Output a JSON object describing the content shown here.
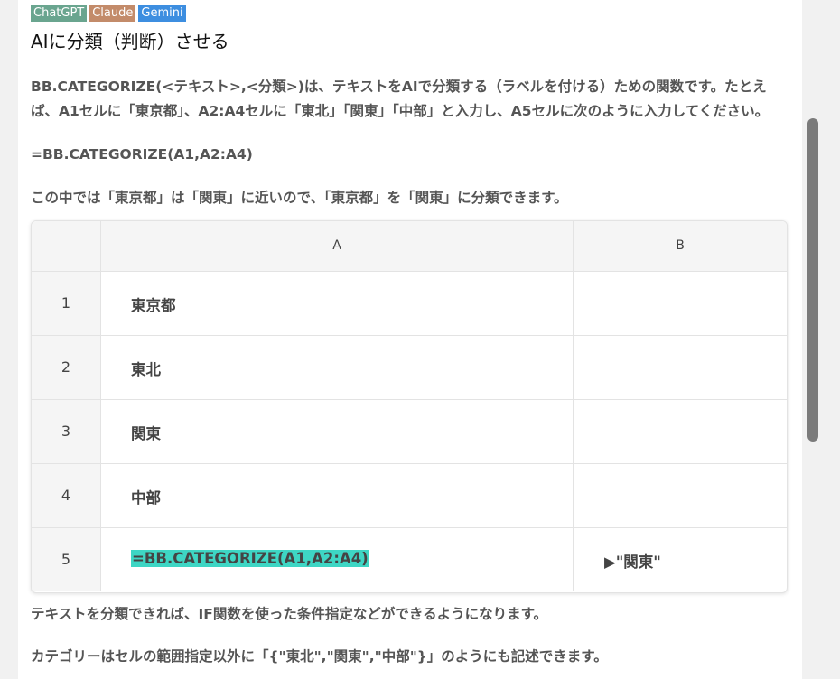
{
  "badges": [
    "ChatGPT",
    "Claude",
    "Gemini"
  ],
  "title": "AIに分類（判断）させる",
  "paragraphs": {
    "intro": "BB.CATEGORIZE(<テキスト>,<分類>)は、テキストをAIで分類する（ラベルを付ける）ための関数です。たとえば、A1セルに「東京都」、A2:A4セルに「東北」「関東」「中部」と入力し、A5セルに次のように入力してください。",
    "formula": "=BB.CATEGORIZE(A1,A2:A4)",
    "explain": "この中では「東京都」は「関東」に近いので、「東京都」を「関東」に分類できます。",
    "after": "テキストを分類できれば、IF関数を使った条件指定などができるようになります。",
    "category_note": "カテゴリーはセルの範囲指定以外に「{\"東北\",\"関東\",\"中部\"}」のようにも記述できます。"
  },
  "sheet": {
    "col_headers": [
      "A",
      "B"
    ],
    "rows": [
      {
        "num": "1",
        "a": "東京都",
        "b": ""
      },
      {
        "num": "2",
        "a": "東北",
        "b": ""
      },
      {
        "num": "3",
        "a": "関東",
        "b": ""
      },
      {
        "num": "4",
        "a": "中部",
        "b": ""
      },
      {
        "num": "5",
        "a": "=BB.CATEGORIZE(A1,A2:A4)",
        "b": "▶\"関東\""
      }
    ]
  },
  "colors": {
    "chatgpt": "#6aa58f",
    "claude": "#c38b6a",
    "gemini": "#3d8ee0",
    "formula_highlight": "#3ed6c4"
  }
}
